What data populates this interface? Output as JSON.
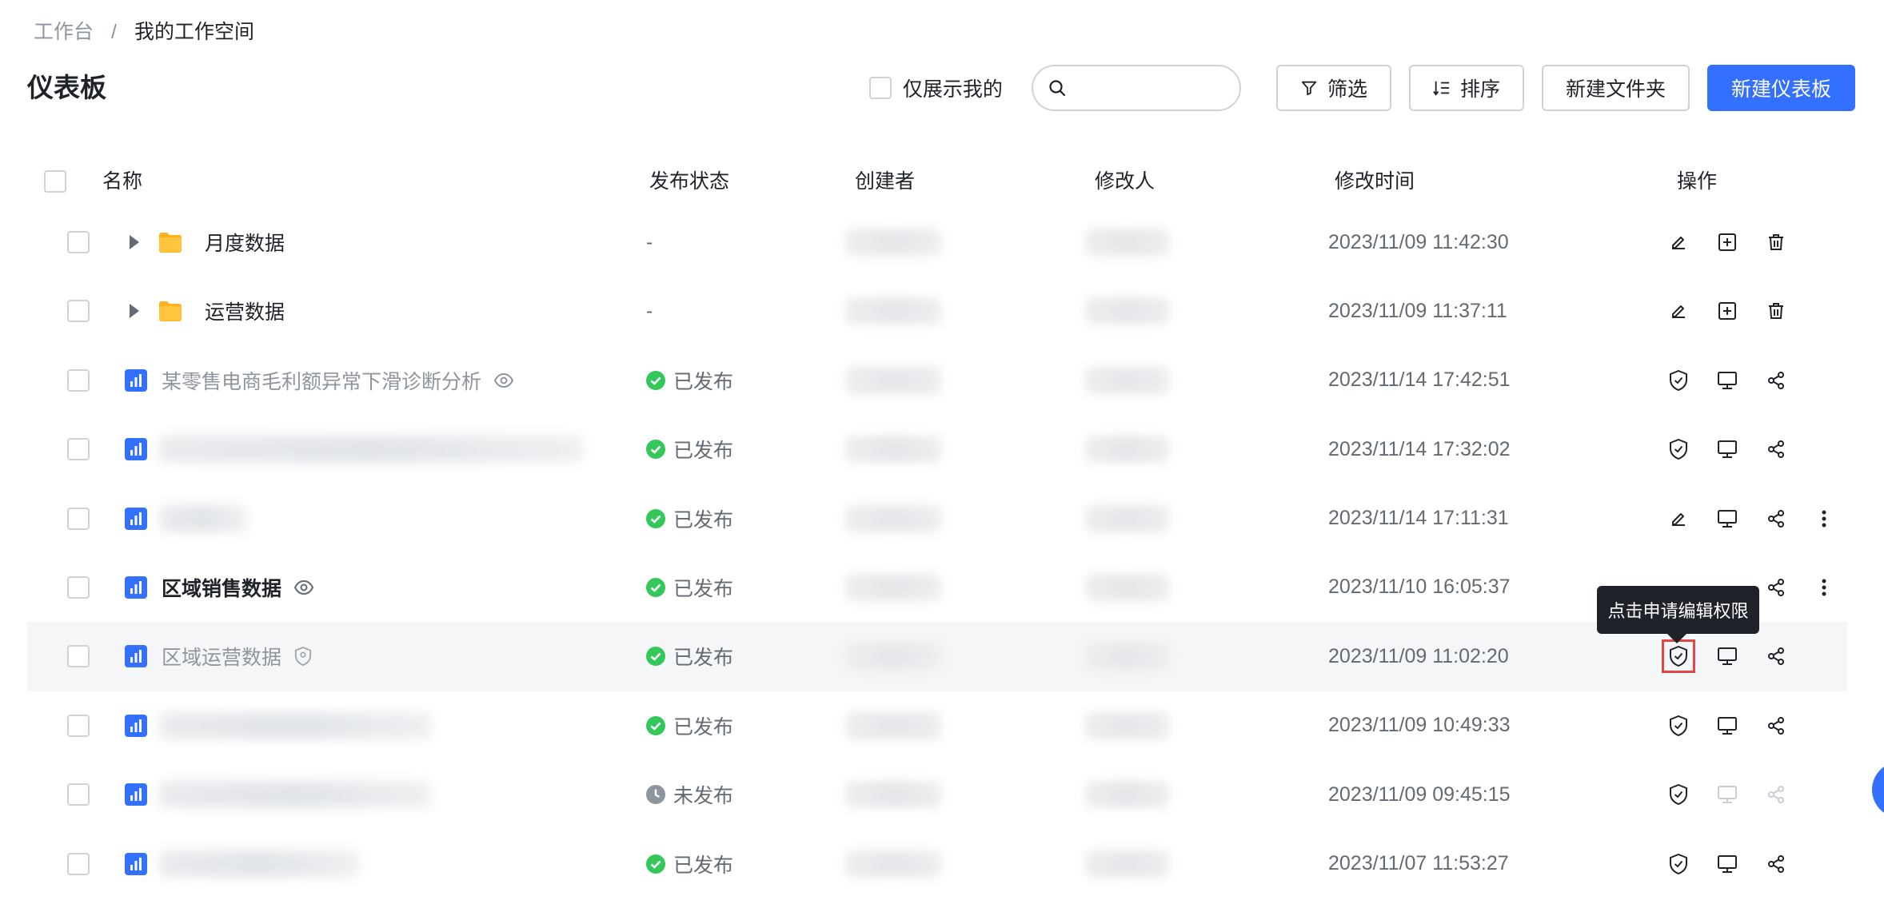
{
  "breadcrumb": {
    "home": "工作台",
    "sep": "/",
    "current": "我的工作空间"
  },
  "page_title": "仪表板",
  "toolbar": {
    "only_mine": "仅展示我的",
    "search_placeholder": "",
    "filter": "筛选",
    "sort": "排序",
    "new_folder": "新建文件夹",
    "new_dashboard": "新建仪表板"
  },
  "table": {
    "headers": {
      "name": "名称",
      "status": "发布状态",
      "creator": "创建者",
      "modifier": "修改人",
      "mtime": "修改时间",
      "ops": "操作"
    },
    "rows": [
      {
        "type": "folder",
        "name": "月度数据",
        "status": "-",
        "time": "2023/11/09 11:42:30"
      },
      {
        "type": "folder",
        "name": "运营数据",
        "status": "-",
        "time": "2023/11/09 11:37:11"
      },
      {
        "type": "dashboard",
        "name": "某零售电商毛利额异常下滑诊断分析",
        "status": "已发布",
        "time": "2023/11/14 17:42:51"
      },
      {
        "type": "dashboard",
        "name": "",
        "status": "已发布",
        "time": "2023/11/14 17:32:02"
      },
      {
        "type": "dashboard",
        "name": "",
        "status": "已发布",
        "time": "2023/11/14 17:11:31"
      },
      {
        "type": "dashboard",
        "name": "区域销售数据",
        "status": "已发布",
        "time": "2023/11/10 16:05:37"
      },
      {
        "type": "dashboard",
        "name": "区域运营数据",
        "status": "已发布",
        "time": "2023/11/09 11:02:20"
      },
      {
        "type": "dashboard",
        "name": "",
        "status": "已发布",
        "time": "2023/11/09 10:49:33"
      },
      {
        "type": "dashboard",
        "name": "",
        "status": "未发布",
        "time": "2023/11/09 09:45:15"
      },
      {
        "type": "dashboard",
        "name": "",
        "status": "已发布",
        "time": "2023/11/07 11:53:27"
      }
    ]
  },
  "tooltip": "点击申请编辑权限",
  "colors": {
    "primary": "#3370ff",
    "success": "#34c759",
    "folder": "#ffb01a",
    "highlight_border": "#e54545"
  }
}
